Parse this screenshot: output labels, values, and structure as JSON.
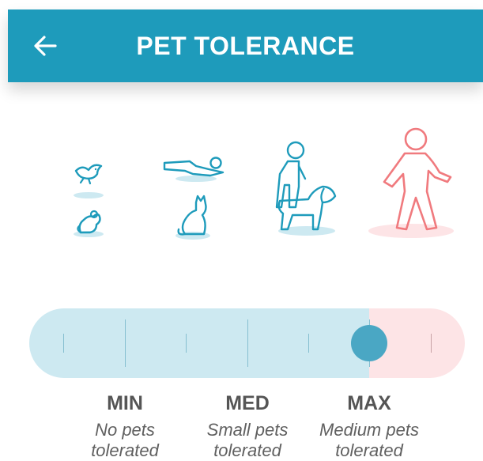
{
  "header": {
    "title": "PET TOLERANCE",
    "back_icon": "arrow-left-icon",
    "background": "#1e9bbb"
  },
  "illustrations": [
    {
      "name": "bird-and-mouse",
      "icons": [
        "bird-icon",
        "mouse-icon"
      ]
    },
    {
      "name": "person-lying-and-cat",
      "icons": [
        "person-lying-icon",
        "cat-icon"
      ]
    },
    {
      "name": "person-walking-dog",
      "icons": [
        "person-icon",
        "dog-icon"
      ]
    },
    {
      "name": "person-walking",
      "icons": [
        "person-walking-icon"
      ],
      "highlighted": true
    }
  ],
  "slider": {
    "value_fraction": 0.78,
    "selected_level": "MAX",
    "fill_color": "#cde9f1",
    "rest_color": "#fde4e6",
    "thumb_color": "#4aa7c4"
  },
  "levels": [
    {
      "label": "MIN",
      "description": "No pets tolerated"
    },
    {
      "label": "MED",
      "description": "Small pets tolerated"
    },
    {
      "label": "MAX",
      "description": "Medium pets tolerated"
    }
  ]
}
